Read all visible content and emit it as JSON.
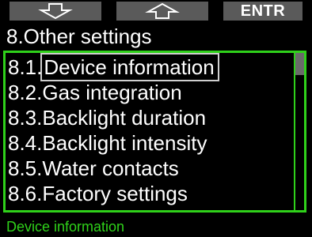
{
  "softkeys": {
    "left_icon": "arrow-down-outline-icon",
    "middle_icon": "arrow-up-outline-icon",
    "right_label": "ENTR"
  },
  "title": "8.Other settings",
  "menu": {
    "items": [
      {
        "number": "8.1.",
        "label": "Device information",
        "selected": true
      },
      {
        "number": "8.2.",
        "label": "Gas integration",
        "selected": false
      },
      {
        "number": "8.3.",
        "label": "Backlight duration",
        "selected": false
      },
      {
        "number": "8.4.",
        "label": "Backlight intensity",
        "selected": false
      },
      {
        "number": "8.5.",
        "label": "Water contacts",
        "selected": false
      },
      {
        "number": "8.6.",
        "label": "Factory settings",
        "selected": false
      }
    ]
  },
  "footer": {
    "help_text": "Device information"
  },
  "colors": {
    "background": "#000000",
    "accent_green": "#2fd11a",
    "softkey_gray": "#5a5a5a",
    "text": "#ffffff"
  }
}
